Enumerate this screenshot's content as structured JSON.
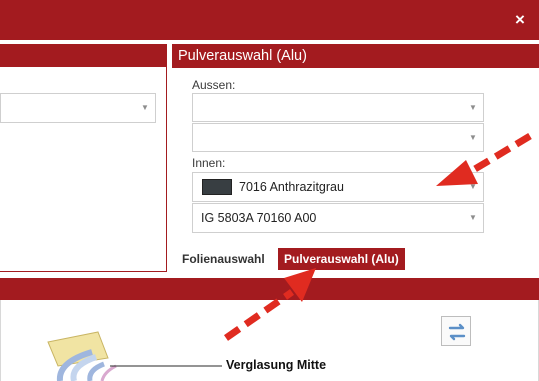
{
  "window": {
    "close_glyph": "×",
    "accent_color": "#a31b1f"
  },
  "right_panel": {
    "title": "Pulverauswahl (Alu)",
    "aussen_label": "Aussen:",
    "aussen_value_1": "",
    "aussen_value_2": "",
    "innen_label": "Innen:",
    "innen_value_1": "7016 Anthrazitgrau",
    "innen_swatch_color": "#383e42",
    "innen_value_2": "IG 5803A 70160 A00"
  },
  "tabs": [
    {
      "label": "Folienauswahl",
      "active": false
    },
    {
      "label": "Pulverauswahl (Alu)",
      "active": true
    }
  ],
  "lower": {
    "glass_label": "Verglasung Mitte",
    "swap_icon": "swap-arrows-icon"
  },
  "annotations": {
    "arrow_color": "#e02b20"
  }
}
